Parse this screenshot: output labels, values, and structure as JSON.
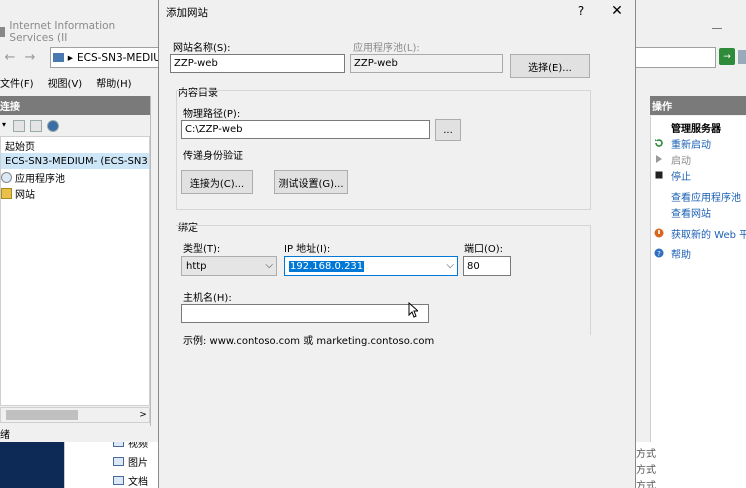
{
  "iis": {
    "title": "Internet Information Services (II",
    "address": "ECS-SN3-MEDIU",
    "menu": [
      "文件(F)",
      "视图(V)",
      "帮助(H)"
    ],
    "connections_header": "连接",
    "tree": [
      {
        "label": "起始页"
      },
      {
        "label": "ECS-SN3-MEDIUM- (ECS-SN3"
      },
      {
        "label": "应用程序池"
      },
      {
        "label": "网站"
      }
    ],
    "scroll_arrow": ">",
    "status": "绪"
  },
  "actions": {
    "header": "操作",
    "items": [
      {
        "label": "管理服务器",
        "style": "bold"
      },
      {
        "label": "重新启动",
        "style": "link",
        "icon": "restart-icon"
      },
      {
        "label": "启动",
        "style": "dis",
        "icon": "start-icon"
      },
      {
        "label": "停止",
        "style": "link",
        "icon": "stop-icon"
      },
      {
        "label": "查看应用程序池",
        "style": "link"
      },
      {
        "label": "查看网站",
        "style": "link"
      },
      {
        "label": "获取新的 Web 平",
        "style": "link",
        "icon": "web-platform-icon"
      },
      {
        "label": "帮助",
        "style": "link",
        "icon": "help-icon"
      }
    ],
    "lower": [
      "方式",
      "方式",
      "方式"
    ]
  },
  "explorer": {
    "items": [
      "视频",
      "图片",
      "文档"
    ]
  },
  "dialog": {
    "title": "添加网站",
    "help": "?",
    "close": "✕",
    "site_name_label": "网站名称(S):",
    "site_name_value": "ZZP-web",
    "app_pool_label": "应用程序池(L):",
    "app_pool_value": "ZZP-web",
    "select_button": "选择(E)...",
    "content_dir_label": "内容目录",
    "physical_path_label": "物理路径(P):",
    "physical_path_value": "C:\\ZZP-web",
    "browse_button": "...",
    "pass_through_label": "传递身份验证",
    "connect_as_button": "连接为(C)...",
    "test_settings_button": "测试设置(G)...",
    "binding_label": "绑定",
    "type_label": "类型(T):",
    "type_value": "http",
    "ip_label": "IP 地址(I):",
    "ip_value": "192.168.0.231",
    "port_label": "端口(O):",
    "port_value": "80",
    "hostname_label": "主机名(H):",
    "hostname_value": "",
    "example_text": "示例: www.contoso.com 或 marketing.contoso.com"
  },
  "colors": {
    "link": "#1a5fb4",
    "selection": "#0078d7",
    "header_bg": "#7a7a7a"
  }
}
